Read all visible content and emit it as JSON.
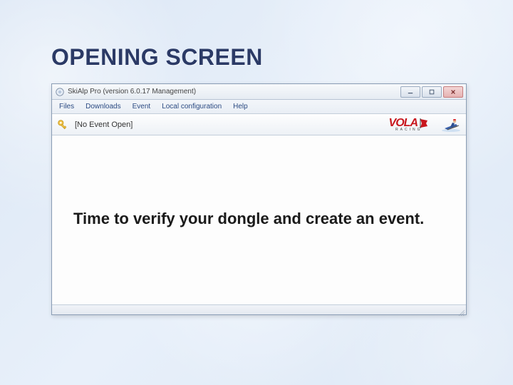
{
  "heading": "OPENING SCREEN",
  "window": {
    "title": "SkiAlp Pro (version 6.0.17 Management)",
    "menu": {
      "files": "Files",
      "downloads": "Downloads",
      "event": "Event",
      "local_configuration": "Local configuration",
      "help": "Help"
    },
    "toolbar": {
      "event_status": "[No Event Open]",
      "logo_brand": "VOLA",
      "logo_sub": "RACING"
    },
    "instruction": "Time to verify your dongle and create an event."
  }
}
